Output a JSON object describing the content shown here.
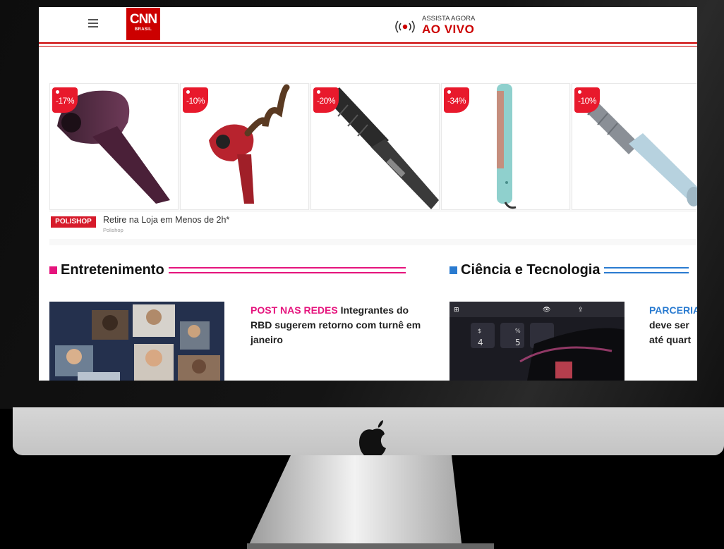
{
  "header": {
    "live_top": "ASSISTA AGORA",
    "live_bottom": "AO VIVO",
    "logo_text": "CNN",
    "logo_subtext": "BRASIL"
  },
  "ad": {
    "products": [
      {
        "discount": "-17%",
        "image": "automatic-hair-curler-purple"
      },
      {
        "discount": "-10%",
        "image": "automatic-hair-curler-red"
      },
      {
        "discount": "-20%",
        "image": "rotating-hot-air-brush-dark"
      },
      {
        "discount": "-34%",
        "image": "flat-iron-teal"
      },
      {
        "discount": "-10%",
        "image": "hot-air-brush-blue"
      }
    ],
    "brand": "POLISHOP",
    "title": "Retire na Loja em Menos de 2h*",
    "source": "Polishop"
  },
  "sections": [
    {
      "title": "Entretenimento",
      "color": "#e5147d",
      "story_tag": "POST NAS REDES",
      "story_text": "Integrantes do RBD sugerem retorno com turnê em janeiro"
    },
    {
      "title": "Ciência e Tecnologia",
      "color": "#2a7bd0",
      "story_tag": "PARCERIA",
      "story_text_line2": "deve ser",
      "story_text_line3": "até quart"
    }
  ],
  "colors": {
    "brand_red": "#cc0000",
    "discount_red": "#e8192c",
    "entertainment_pink": "#e5147d",
    "science_blue": "#2a7bd0"
  }
}
